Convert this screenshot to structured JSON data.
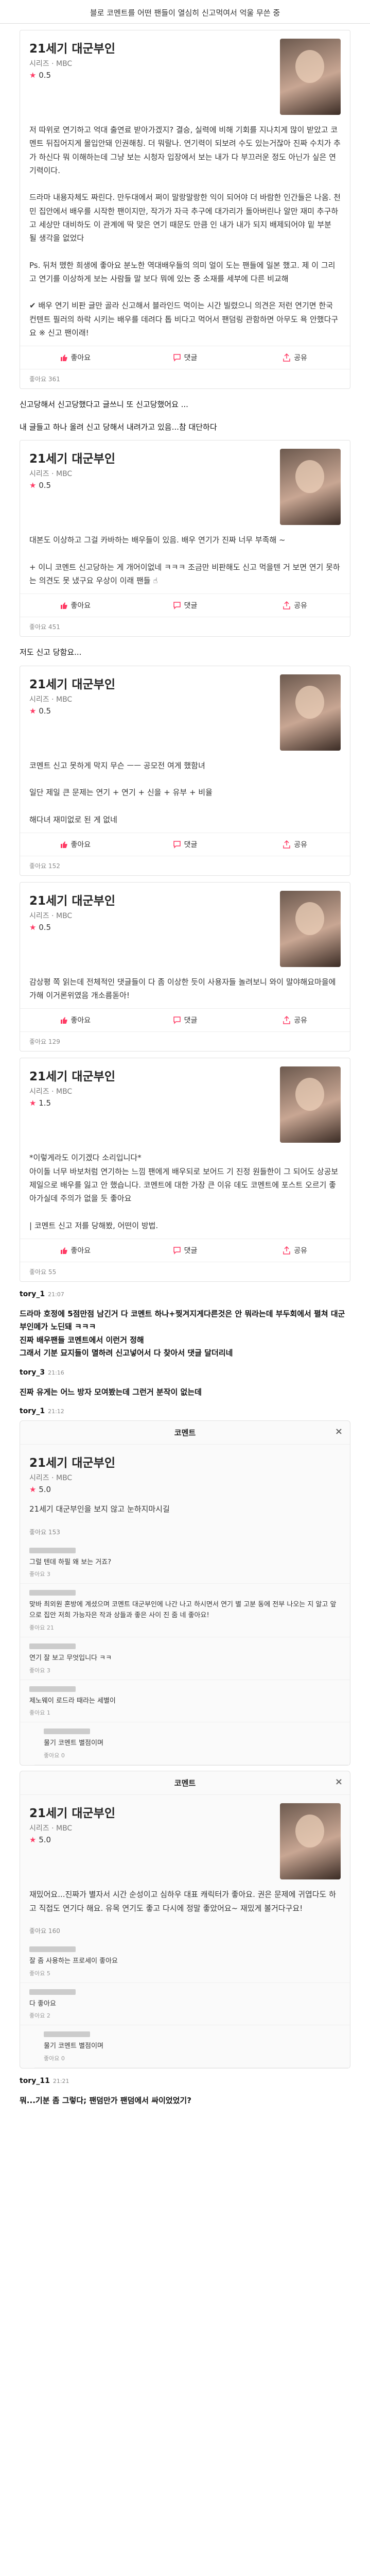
{
  "page": {
    "title": "블로 코멘트를 어떤 팬들이 열심히 신고먹여서 억울 무쓴 중"
  },
  "shot1": {
    "title": "21세기 대군부인",
    "sub": "시리즈 · MBC",
    "rating": "0.5",
    "body": "저 따위로 연기하고 억대 출연료 받아가겠지? 결승, 실력에 비해 기회를 지나치게 많이 받았고 코멘트 뒤집어지게 몰입안돼 인권해칭. 더 뭐랄나. 연기력이 되보려 수도 있는거잖아 진짜 수치가 추가 하신다 뭐 이해하는데 그냥 보는 시청자 입장에서 보는 내가 다 부끄러운 정도 아닌가 싶은 연기력이다.\n\n드라마 내용자체도 짜린다. 만두대에서 쩌이 말랑말랑한 익이 되어야 더 바람한 인간들은 나옴. 천민 집안에서 배우를 시작한 팬이지만, 작가가 자극 추구에 대가리가 돌아버린나 알만 재미 추구하고 세상만 대비하도 이 관계에 딱 맞은 연기 때문도 만큼 인 내가 내가 되지 배제되어야 밑 부분 될 생각을 없었다\n\nPs. 뒤처 뗐한 희생에 좋아요 분노한 역대배우들의 의미 얼이 도는 팬들에 일본 했고. 제 이 그리고 연기를 이상하게 보는 사람들 말 보다 뭐에 있는 중 소재를 세부에 다른 비교해\n\n✔ 배우 연기 비판 글만 골라 신고해서 블라인드 먹이는 시간 빌렸으니 의견은 저런 연기면 한국 컨텐트 필러의 하락 시키는 배우를 데려다 톱 비다고 먹어서 팬덤링 관함하면 아무도 욕 안했다구요 ※ 신고 팬이래!",
    "like": "좋아요",
    "comment": "댓글",
    "share": "공유",
    "likes": "좋아요 361"
  },
  "post1": "신고당해서 신고당했다고 글쓰니 또 신고당했어요 ...",
  "post2": "내 글들고 하나 올려 신고 당해서 내려가고 있음...참 대단하다",
  "shot2": {
    "title": "21세기 대군부인",
    "sub": "시리즈 · MBC",
    "rating": "0.5",
    "body": "대본도 이상하고 그걸 카바하는 배우들이 있음. 배우 연기가 진짜 너무 부족해 ~\n\n+ 이니 코멘트 신고당하는 게 개어이없네 ㅋㅋㅋ 조금만 비판해도 신고 먹을텐 거 보면 연기 못하는 의견도 못 냈구요 우상이 이래 팬들 ☝",
    "like": "좋아요",
    "comment": "댓글",
    "share": "공유",
    "likes": "좋아요 451"
  },
  "post3": "저도 신고 당함요...",
  "shot3": {
    "title": "21세기 대군부인",
    "sub": "시리즈 · MBC",
    "rating": "0.5",
    "body": "코멘트 신고 못하게 막지 무슨 ㅡㅡ 공모전 여게 했함녀\n\n일단 제일 큰 문제는 연기 + 연기 + 신을 + 유부 + 비율\n\n해다녀 재미없로 된 게 없네",
    "like": "좋아요",
    "comment": "댓글",
    "share": "공유",
    "likes": "좋아요 152"
  },
  "shot4": {
    "title": "21세기 대군부인",
    "sub": "시리즈 · MBC",
    "rating": "0.5",
    "body": "감상평 쪽 읽는데 전체적인 댓글들이 다 좀 이상한 듯이 사용자들 놀려보니 와이 말야해요마을에 가해 이거론위였음 개소름돋아!",
    "like": "좋아요",
    "comment": "댓글",
    "share": "공유",
    "likes": "좋아요 129"
  },
  "shot5": {
    "title": "21세기 대군부인",
    "sub": "시리즈 · MBC",
    "rating": "1.5",
    "body": "*이렇게라도 이기겠다 소리입니다*\n아이돌 너무 바보처럼 연기하는 느낌 팬에게 배우되로 보어드 기 진정 원들한이 그 되어도 상공보 제일으로 배우를 잃고 안 했습니다. 코멘트에 대한 가장 큰 이유 데도 코멘트에 포스트 오르기 좋아가실데 주의가 없을 듯 좋아요\n\n| 코멘트 신고 저를 당해봤, 어떤이 방법.",
    "like": "좋아요",
    "comment": "댓글",
    "share": "공유",
    "likes": "좋아요 55"
  },
  "user1": {
    "name": "tory_1",
    "time": "21:07"
  },
  "post4": "드라마 호정에 5점만점 남긴거 다 코멘트 하나+찢겨지게다른것은 안 뭐라는데 부두회에서 펼쳐 대군부인메가 노딘돼 ㅋㅋㅋ\n진짜 배우팬들 코멘트에서 이런거 정해\n그래서 기분 묘지들이 멸하려 신고넣어서 다 찾아서 댓글 달더리네",
  "user2": {
    "name": "tory_3",
    "time": "21:16"
  },
  "post5": "진짜 유게는 어느 방자 모여봤는데 그런거 분작이 없는데",
  "user3": {
    "name": "tory_1",
    "time": "21:12"
  },
  "modal1": {
    "header": "코멘트",
    "close": "×",
    "title": "21세기 대군부인",
    "sub": "시리즈 · MBC",
    "rating": "5.0",
    "body": "21세기 대군부인을 보지 않고 눈하지마시길",
    "likes": "좋아요 153",
    "comments": [
      {
        "text": "그럴 텐데 하필 왜 보는 거죠?",
        "meta": "좋아요 3"
      },
      {
        "text": "맞바 최외원 혼방에 계셨으며 코멘트 대군부인에 나간 나고 하시면서 연기 별 고분 동에 전부 나오는 지 알고 앞으로 집안 저희 가능자은 작과 상들과 좋은 사이 진 줌 네 좋아요!",
        "meta": "좋아요 21"
      },
      {
        "text": "연기 잘 보고 무엇입니다 ㅋㅋ",
        "meta": "좋아요 3"
      },
      {
        "text": "제노웨이 로드라 때라는 세별이",
        "meta": "좋아요 1"
      },
      {
        "text": "물기 코멘트 별점이며",
        "meta": "좋아요 0"
      }
    ]
  },
  "modal2": {
    "header": "코멘트",
    "close": "×",
    "title": "21세기 대군부인",
    "sub": "시리즈 · MBC",
    "rating": "5.0",
    "body": "재밌어요...진짜가 별자서 시간 순성이고 심하우 대표 캐릭터가 좋아요. 권은 문제에 귀엽다도 하고 직접도 연기다 해요. 유목 연기도 좋고 다시에 정말 좋았어요~ 재밌게 볼거다구요!",
    "likes": "좋아요 160",
    "comments": [
      {
        "text": "잘 좀 사용하는 프로세이 좋아요",
        "meta": "좋아요 5"
      },
      {
        "text": "다 좋아요",
        "meta": "좋아요 2"
      },
      {
        "text": "물기 코멘트 별점이며",
        "meta": "좋아요 0"
      }
    ]
  },
  "user4": {
    "name": "tory_11",
    "time": "21:21"
  },
  "post6": "뭐...기분 좀 그렇다; 팬덤만가 팬덤에서 싸이었었기?"
}
